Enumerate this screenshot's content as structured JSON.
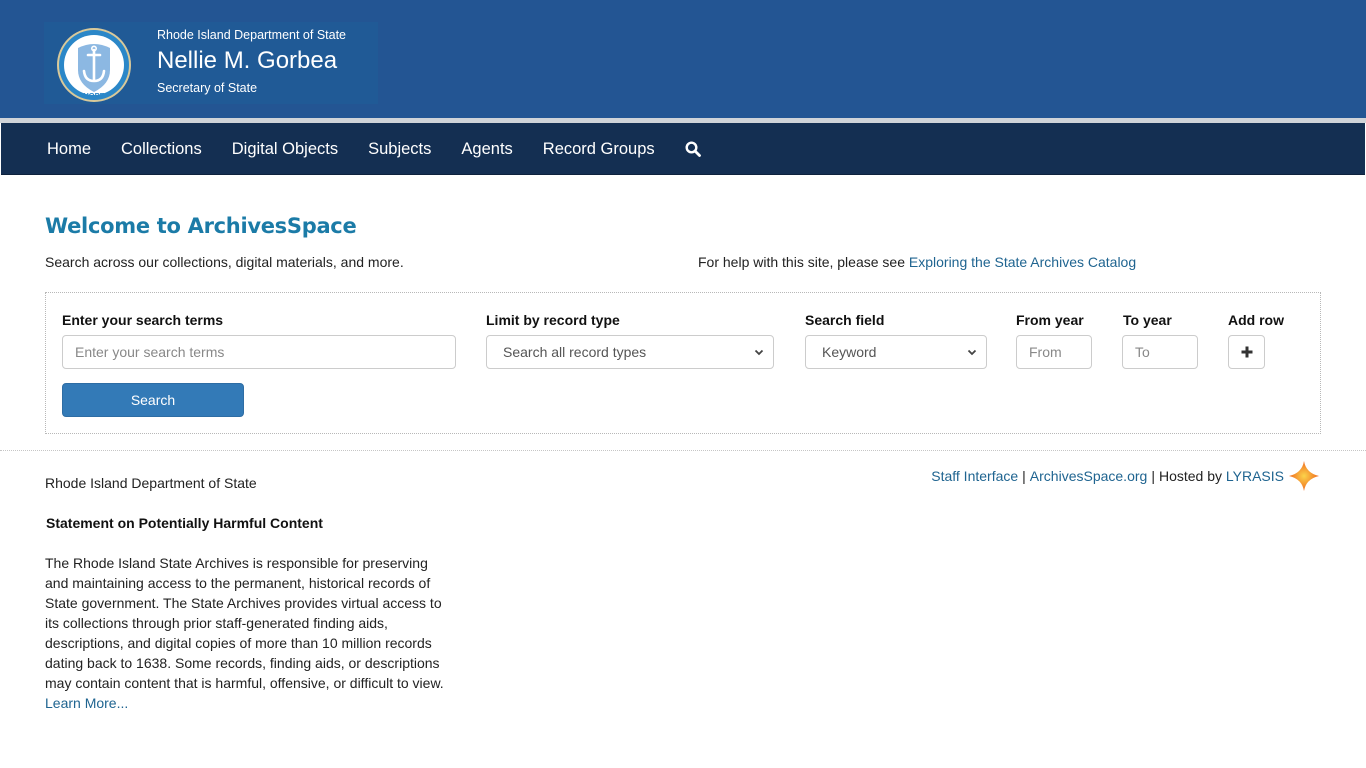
{
  "header": {
    "department": "Rhode Island Department of State",
    "name": "Nellie M. Gorbea",
    "title": "Secretary of State",
    "seal_text": "HOPE"
  },
  "nav": {
    "items": [
      {
        "label": "Home"
      },
      {
        "label": "Collections"
      },
      {
        "label": "Digital Objects"
      },
      {
        "label": "Subjects"
      },
      {
        "label": "Agents"
      },
      {
        "label": "Record Groups"
      }
    ],
    "search_icon": "search-icon"
  },
  "main": {
    "heading": "Welcome to ArchivesSpace",
    "intro": "Search across our collections, digital materials, and more.",
    "help_prefix": "For help with this site, please see ",
    "help_link": "Exploring the State Archives Catalog"
  },
  "search": {
    "terms_label": "Enter your search terms",
    "terms_placeholder": "Enter your search terms",
    "terms_value": "",
    "record_type_label": "Limit by record type",
    "record_type_value": "Search all record types",
    "field_label": "Search field",
    "field_value": "Keyword",
    "from_label": "From year",
    "from_placeholder": "From",
    "to_label": "To year",
    "to_placeholder": "To",
    "add_row_label": "Add row",
    "add_row_icon": "plus-icon",
    "search_button": "Search"
  },
  "footer": {
    "org": "Rhode Island Department of State",
    "statement_title": "Statement on Potentially Harmful Content",
    "statement_body": "The Rhode Island State Archives is responsible for preserving and maintaining access to the permanent, historical records of State government. The State Archives provides virtual access to its collections through prior staff-generated finding aids, descriptions, and digital copies of more than 10 million records dating back to 1638. Some records, finding aids, or descriptions may contain content that is harmful, offensive, or difficult to view.",
    "learn_more": "Learn More...",
    "links": {
      "staff_interface": "Staff Interface",
      "separator": "|",
      "archivesspace_org": "ArchivesSpace.org",
      "hosted_by": "Hosted by ",
      "lyrasis": "LYRASIS"
    }
  },
  "colors": {
    "header_bg": "#235593",
    "nav_bg": "#142f52",
    "heading": "#1b7ba7",
    "link": "#1f6490",
    "primary_button": "#337ab7",
    "lyrasis_star": "#f47b20"
  }
}
